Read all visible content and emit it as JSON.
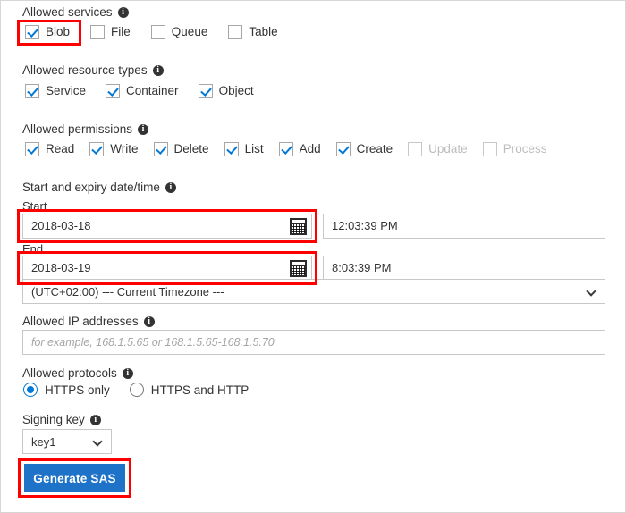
{
  "form": {
    "allowed_services": {
      "label": "Allowed services",
      "info_icon": "info-icon",
      "options": [
        {
          "label": "Blob",
          "checked": true,
          "disabled": false
        },
        {
          "label": "File",
          "checked": false,
          "disabled": false
        },
        {
          "label": "Queue",
          "checked": false,
          "disabled": false
        },
        {
          "label": "Table",
          "checked": false,
          "disabled": false
        }
      ]
    },
    "allowed_resource_types": {
      "label": "Allowed resource types",
      "info_icon": "info-icon",
      "options": [
        {
          "label": "Service",
          "checked": true,
          "disabled": false
        },
        {
          "label": "Container",
          "checked": true,
          "disabled": false
        },
        {
          "label": "Object",
          "checked": true,
          "disabled": false
        }
      ]
    },
    "allowed_permissions": {
      "label": "Allowed permissions",
      "info_icon": "info-icon",
      "options": [
        {
          "label": "Read",
          "checked": true,
          "disabled": false
        },
        {
          "label": "Write",
          "checked": true,
          "disabled": false
        },
        {
          "label": "Delete",
          "checked": true,
          "disabled": false
        },
        {
          "label": "List",
          "checked": true,
          "disabled": false
        },
        {
          "label": "Add",
          "checked": true,
          "disabled": false
        },
        {
          "label": "Create",
          "checked": true,
          "disabled": false
        },
        {
          "label": "Update",
          "checked": false,
          "disabled": true
        },
        {
          "label": "Process",
          "checked": false,
          "disabled": true
        }
      ]
    },
    "date_time": {
      "label": "Start and expiry date/time",
      "info_icon": "info-icon",
      "start_label": "Start",
      "start_date": "2018-03-18",
      "start_time": "12:03:39 PM",
      "end_label": "End",
      "end_date": "2018-03-19",
      "end_time": "8:03:39 PM",
      "calendar_icon": "calendar-icon",
      "timezone": "(UTC+02:00) --- Current Timezone ---"
    },
    "allowed_ip": {
      "label": "Allowed IP addresses",
      "info_icon": "info-icon",
      "value": "",
      "placeholder": "for example, 168.1.5.65 or 168.1.5.65-168.1.5.70"
    },
    "allowed_protocols": {
      "label": "Allowed protocols",
      "info_icon": "info-icon",
      "options": [
        {
          "label": "HTTPS only",
          "selected": true
        },
        {
          "label": "HTTPS and HTTP",
          "selected": false
        }
      ]
    },
    "signing_key": {
      "label": "Signing key",
      "info_icon": "info-icon",
      "value": "key1"
    },
    "generate_button": {
      "label": "Generate SAS"
    }
  },
  "colors": {
    "accent_blue": "#0078d7",
    "button_blue": "#1e72c8",
    "annotation_red": "#ff0000",
    "text": "#333333",
    "disabled_text": "#bdbdbd",
    "border": "#c8c8c8"
  },
  "annotations": [
    {
      "name": "highlight-blob-checkbox"
    },
    {
      "name": "highlight-start-date"
    },
    {
      "name": "highlight-end-date"
    },
    {
      "name": "highlight-generate-sas"
    }
  ]
}
